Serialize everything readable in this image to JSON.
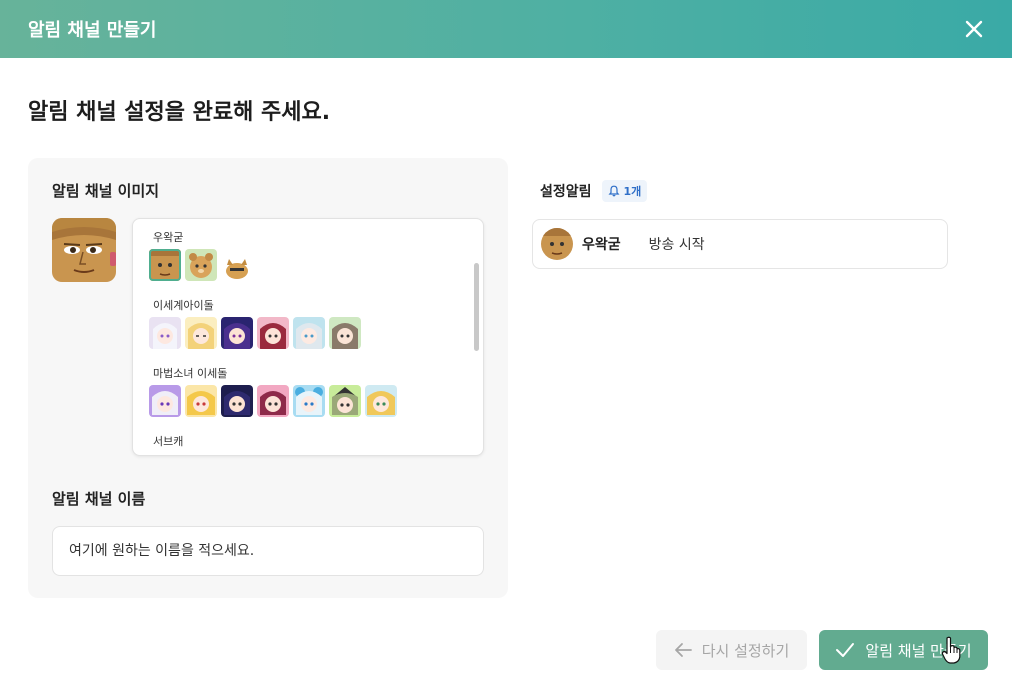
{
  "header": {
    "title": "알림 채널 만들기"
  },
  "page_title": "알림 채널 설정을 완료해 주세요.",
  "image_section": {
    "label": "알림 채널 이미지",
    "groups": [
      {
        "name": "우왁굳",
        "count": 3
      },
      {
        "name": "이세계아이돌",
        "count": 6
      },
      {
        "name": "마법소녀 이세돌",
        "count": 7
      },
      {
        "name": "서브캐",
        "count": 0
      }
    ]
  },
  "name_section": {
    "label": "알림 채널 이름",
    "placeholder": "여기에 원하는 이름을 적으세요."
  },
  "alerts": {
    "label": "설정알림",
    "count": "1개",
    "items": [
      {
        "name": "우왁굳",
        "event": "방송 시작"
      }
    ]
  },
  "buttons": {
    "reset": "다시 설정하기",
    "create": "알림 채널 만들기"
  },
  "colors": {
    "accent": "#62ab90",
    "header_start": "#67b39a",
    "header_end": "#3aaaa6",
    "badge_text": "#2f6fc8"
  }
}
